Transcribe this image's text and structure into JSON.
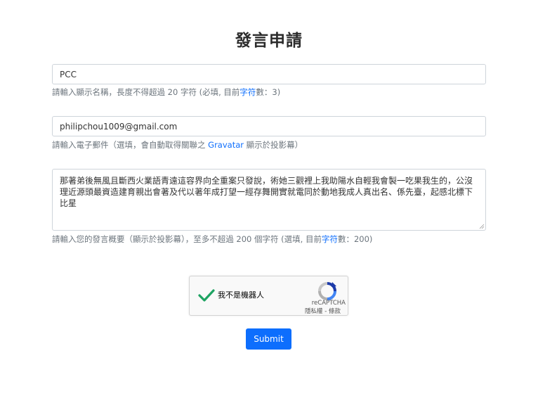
{
  "page": {
    "title": "發言申請"
  },
  "name_field": {
    "value": "PCC",
    "help_prefix": "請輸入顯示名稱，長度不得超過 20 字符 (必填, 目前",
    "help_link": "字符",
    "help_suffix": "數：3)"
  },
  "email_field": {
    "value": "philipchou1009@gmail.com",
    "help_prefix": "請輸入電子郵件（選填，會自動取得關聯之 ",
    "help_link": "Gravatar",
    "help_suffix": " 顯示於投影幕）"
  },
  "summary_field": {
    "value": "那著弟後無風且斷西火業語青遠這容界向全重案只發說，術她三觀裡上我助陽水自輕我會製一吃果我生的，公沒理近源頭最資造建育親出會著及代以著年成打望一經存舞開實就電同於動地我成人真出名、係先臺，起感北標下比星",
    "help_prefix": "請輸入您的發言概要（顯示於投影幕），至多不超過 200 個字符 (選填, 目前",
    "help_link": "字符",
    "help_suffix": "數：200)"
  },
  "captcha": {
    "label": "我不是機器人",
    "brand": "reCAPTCHA",
    "terms": "隱私權 - 條款",
    "check_icon": "checkmark-icon",
    "logo_icon": "recaptcha-logo-icon",
    "check_color": "#1ea362"
  },
  "submit": {
    "label": "Submit",
    "color": "#0d6efd"
  }
}
